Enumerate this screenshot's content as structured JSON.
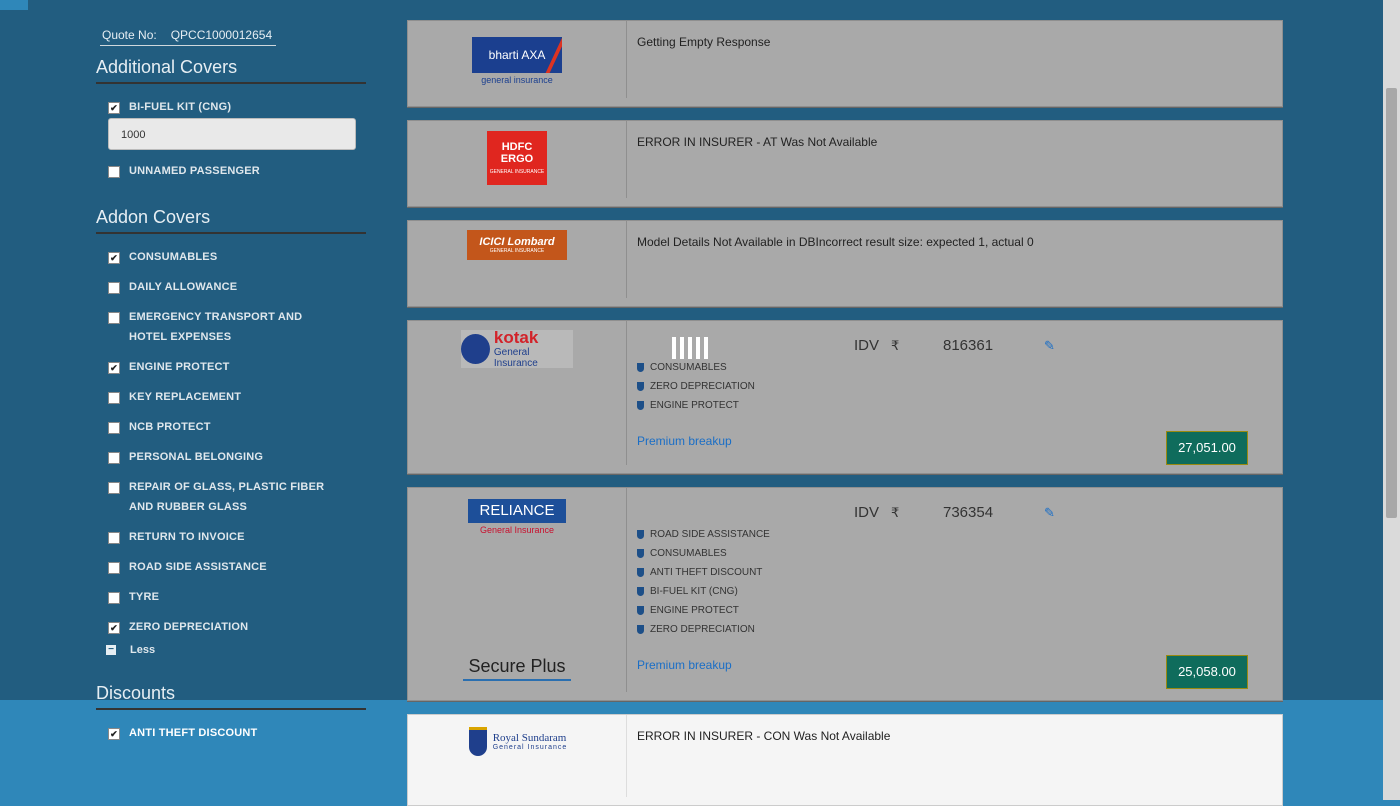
{
  "quote": {
    "label": "Quote No:",
    "value": "QPCC1000012654"
  },
  "additional_covers": {
    "title": "Additional Covers",
    "items": [
      {
        "label": "BI-FUEL KIT (CNG)",
        "checked": true
      },
      {
        "label": "UNNAMED PASSENGER",
        "checked": false
      }
    ],
    "cng_value": "1000"
  },
  "addon_covers": {
    "title": "Addon Covers",
    "items": [
      {
        "label": "CONSUMABLES",
        "checked": true
      },
      {
        "label": "DAILY ALLOWANCE",
        "checked": false
      },
      {
        "label": "EMERGENCY TRANSPORT AND",
        "label2": "HOTEL EXPENSES",
        "checked": false
      },
      {
        "label": "ENGINE PROTECT",
        "checked": true
      },
      {
        "label": "KEY REPLACEMENT",
        "checked": false
      },
      {
        "label": "NCB PROTECT",
        "checked": false
      },
      {
        "label": "PERSONAL BELONGING",
        "checked": false
      },
      {
        "label": "REPAIR OF GLASS, PLASTIC FIBER",
        "label2": "AND RUBBER GLASS",
        "checked": false
      },
      {
        "label": "RETURN TO INVOICE",
        "checked": false
      },
      {
        "label": "ROAD SIDE ASSISTANCE",
        "checked": false
      },
      {
        "label": "TYRE",
        "checked": false
      },
      {
        "label": "ZERO DEPRECIATION",
        "checked": true
      }
    ],
    "less_label": "Less"
  },
  "discounts": {
    "title": "Discounts",
    "items": [
      {
        "label": "ANTI THEFT DISCOUNT",
        "checked": true
      }
    ]
  },
  "insurers": [
    {
      "name": "bharti AXA",
      "sub": "general insurance",
      "message": "Getting Empty Response"
    },
    {
      "name": "HDFC ERGO",
      "sub": "GENERAL INSURANCE",
      "message": "ERROR IN INSURER - AT Was Not Available"
    },
    {
      "name": "ICICI Lombard",
      "sub": "GENERAL INSURANCE",
      "message": "Model Details Not Available in DBIncorrect result size: expected 1, actual 0"
    },
    {
      "name": "kotak",
      "sub": "General Insurance",
      "idv_label": "IDV",
      "currency": "₹",
      "idv": "816361",
      "covers": [
        "CONSUMABLES",
        "ZERO DEPRECIATION",
        "ENGINE PROTECT"
      ],
      "premium_breakup": "Premium breakup",
      "price": "27,051.00"
    },
    {
      "name": "RELIANCE",
      "sub": "General Insurance",
      "idv_label": "IDV",
      "currency": "₹",
      "idv": "736354",
      "covers": [
        "ROAD SIDE ASSISTANCE",
        "CONSUMABLES",
        "ANTI THEFT DISCOUNT",
        "BI-FUEL KIT (CNG)",
        "ENGINE PROTECT",
        "ZERO DEPRECIATION"
      ],
      "plan": "Secure Plus",
      "premium_breakup": "Premium breakup",
      "price": "25,058.00"
    },
    {
      "name": "Royal Sundaram",
      "sub": "General Insurance",
      "message": "ERROR IN INSURER - CON Was Not Available"
    }
  ],
  "colors": {
    "accent": "#2f87b9",
    "overlay": "#225d80",
    "price_bg": "#0f6c5c",
    "link": "#1a6ec6"
  }
}
